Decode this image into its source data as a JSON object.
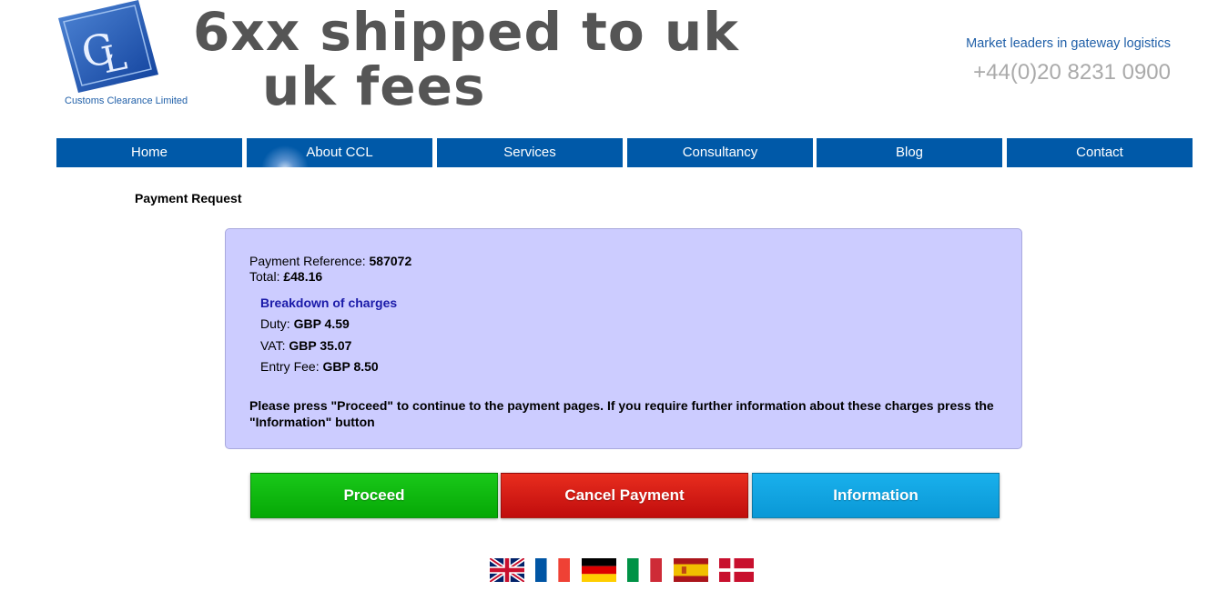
{
  "header": {
    "logo_caption": "Customs Clearance Limited",
    "overlay_line1": "6xx shipped to uk",
    "overlay_line2": "uk fees",
    "tagline": "Market leaders in gateway logistics",
    "phone": "+44(0)20 8231 0900"
  },
  "nav": {
    "items": [
      {
        "label": "Home"
      },
      {
        "label": "About CCL"
      },
      {
        "label": "Services"
      },
      {
        "label": "Consultancy"
      },
      {
        "label": "Blog"
      },
      {
        "label": "Contact"
      }
    ]
  },
  "page": {
    "heading": "Payment Request"
  },
  "payment": {
    "reference_label": "Payment Reference:",
    "reference_value": "587072",
    "total_label": "Total:",
    "total_value": "£48.16",
    "breakdown_title": "Breakdown of charges",
    "charges": [
      {
        "label": "Duty:",
        "value": "GBP 4.59"
      },
      {
        "label": "VAT:",
        "value": "GBP 35.07"
      },
      {
        "label": "Entry Fee:",
        "value": "GBP 8.50"
      }
    ],
    "note": "Please press \"Proceed\" to continue to the payment pages. If you require further information about these charges press the \"Information\" button"
  },
  "actions": {
    "proceed": "Proceed",
    "cancel": "Cancel Payment",
    "information": "Information"
  },
  "flags": [
    "uk-flag-icon",
    "france-flag-icon",
    "germany-flag-icon",
    "italy-flag-icon",
    "spain-flag-icon",
    "denmark-flag-icon"
  ],
  "colors": {
    "nav_bg": "#0059a8",
    "panel_bg": "#ccccff",
    "proceed": "#0cb80c",
    "cancel": "#d41a14",
    "information": "#12a4e2"
  }
}
